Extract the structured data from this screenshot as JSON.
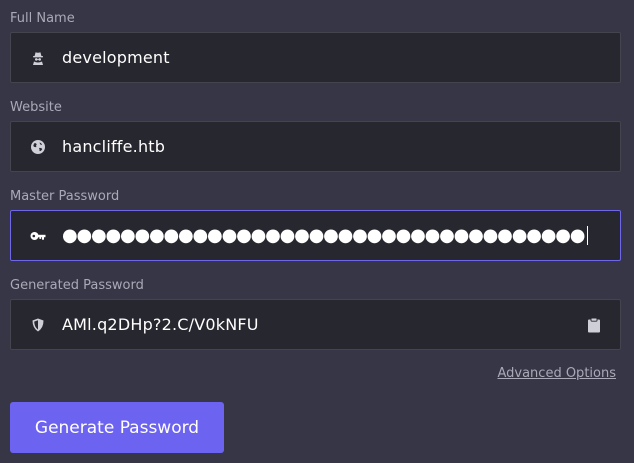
{
  "form": {
    "full_name": {
      "label": "Full Name",
      "value": "development",
      "icon": "user-secret-icon"
    },
    "website": {
      "label": "Website",
      "value": "hancliffe.htb",
      "icon": "globe-icon"
    },
    "master_password": {
      "label": "Master Password",
      "value": "●●●●●●●●●●●●●●●●●●●●●●●●●●●●●●●●●●●●",
      "icon": "key-icon"
    },
    "generated_password": {
      "label": "Generated Password",
      "value": "AMl.q2DHp?2.C/V0kNFU",
      "icon": "shield-icon",
      "action_icon": "clipboard-icon"
    }
  },
  "advanced_options_label": "Advanced Options",
  "generate_button_label": "Generate Password",
  "colors": {
    "background": "#363646",
    "field_bg": "#27272f",
    "accent": "#6c63f0",
    "focus_border": "#6f66e8",
    "label_text": "#a9a9b8"
  }
}
